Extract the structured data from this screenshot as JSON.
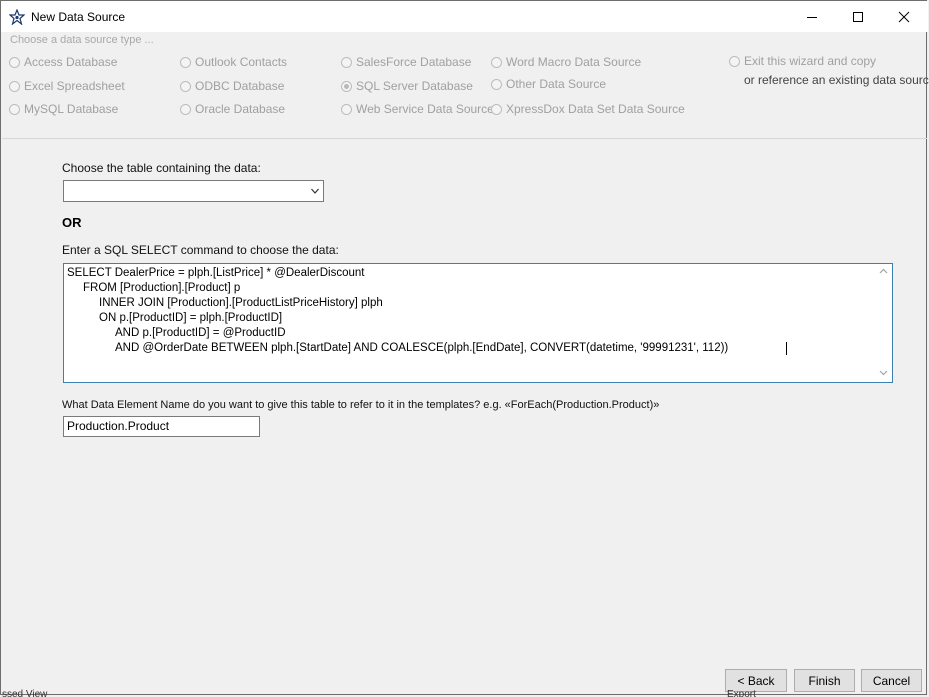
{
  "window": {
    "title": "New Data Source"
  },
  "source_type": {
    "legend": "Choose a data source type ...",
    "options": [
      {
        "label": "Access Database",
        "checked": false
      },
      {
        "label": "Excel Spreadsheet",
        "checked": false
      },
      {
        "label": "MySQL Database",
        "checked": false
      },
      {
        "label": "Outlook Contacts",
        "checked": false
      },
      {
        "label": "ODBC Database",
        "checked": false
      },
      {
        "label": "Oracle Database",
        "checked": false
      },
      {
        "label": "SalesForce Database",
        "checked": false
      },
      {
        "label": "SQL Server Database",
        "checked": true
      },
      {
        "label": "Web Service Data Source",
        "checked": false
      },
      {
        "label": "Word Macro Data Source",
        "checked": false
      },
      {
        "label": "Other Data Source",
        "checked": false
      },
      {
        "label": "XpressDox Data Set Data Source",
        "checked": false
      },
      {
        "label": "Exit this wizard and copy",
        "checked": false
      }
    ],
    "exit_line2": "or reference an existing data source"
  },
  "table": {
    "label": "Choose the table containing the data:",
    "selected": ""
  },
  "or_label": "OR",
  "sql": {
    "label": "Enter a SQL SELECT command to choose the data:",
    "lines": [
      "SELECT DealerPrice = plph.[ListPrice] * @DealerDiscount",
      "FROM [Production].[Product] p",
      "INNER JOIN [Production].[ProductListPriceHistory] plph",
      "ON p.[ProductID] = plph.[ProductID]",
      "AND p.[ProductID] = @ProductID",
      "AND @OrderDate BETWEEN plph.[StartDate] AND COALESCE(plph.[EndDate], CONVERT(datetime, '99991231', 112))"
    ]
  },
  "element_name": {
    "label": "What Data Element Name do you want to give this table to refer to it in the templates? e.g. «ForEach(Production.Product)»",
    "value": "Production.Product"
  },
  "buttons": {
    "back": "< Back",
    "finish": "Finish",
    "cancel": "Cancel"
  },
  "background_fragments": {
    "left_bottom": "ssed View",
    "right_bottom": "Export"
  },
  "colors": {
    "sql_border": "#3c7fb1",
    "disabled_text": "#a0a0a0"
  },
  "icons": [
    "star-app-icon",
    "minimize-icon",
    "maximize-icon",
    "close-icon",
    "chevron-down-icon",
    "scroll-up-icon",
    "scroll-down-icon"
  ]
}
